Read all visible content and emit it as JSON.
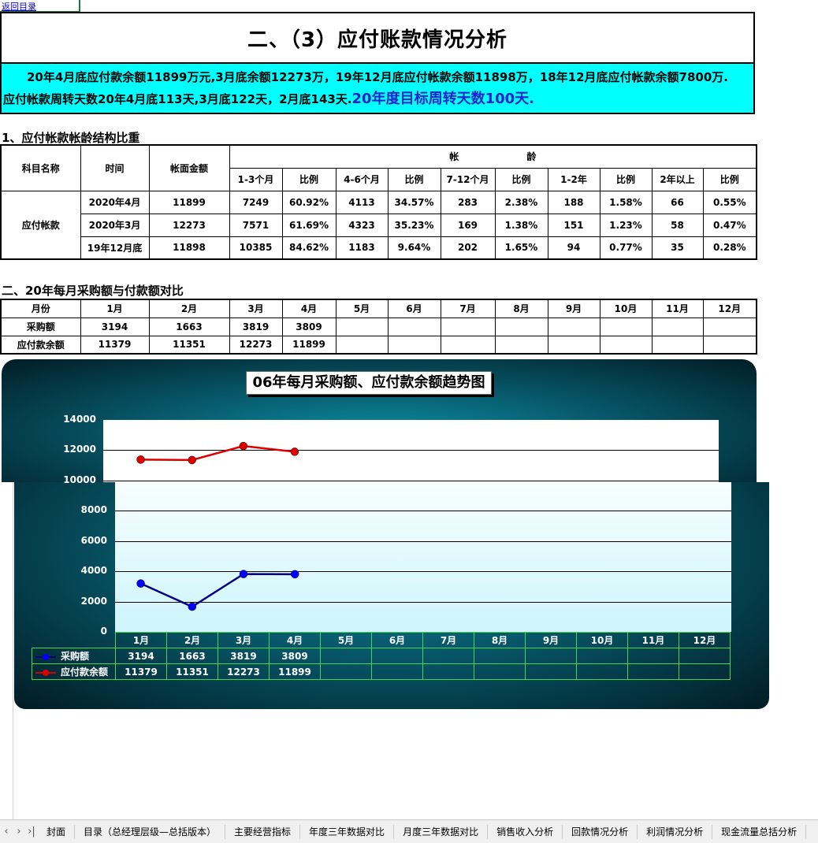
{
  "back_link": "返回目录",
  "title": "二、（3）应付账款情况分析",
  "summary": {
    "line1": "20年4月底应付款余额11899万元,3月底余额12273万，19年12月底应付帐款余额11898万，18年12月底应付帐款余额7800万.",
    "line2": "应付帐款周转天数20年4月底113天,3月底122天，2月底143天.",
    "target": "20年度目标周转天数100天."
  },
  "section1": "1、应付帐款帐龄结构比重",
  "aging": {
    "h_subject": "科目名称",
    "h_time": "时间",
    "h_amount": "帐面金额",
    "h_age1": "帐",
    "h_age2": "龄",
    "buckets": [
      "1-3个月",
      "比例",
      "4-6个月",
      "比例",
      "7-12个月",
      "比例",
      "1-2年",
      "比例",
      "2年以上",
      "比例"
    ],
    "subject": "应付帐款",
    "rows": [
      {
        "time": "2020年4月",
        "amount": "11899",
        "cells": [
          "7249",
          "60.92%",
          "4113",
          "34.57%",
          "283",
          "2.38%",
          "188",
          "1.58%",
          "66",
          "0.55%"
        ]
      },
      {
        "time": "2020年3月",
        "amount": "12273",
        "cells": [
          "7571",
          "61.69%",
          "4323",
          "35.23%",
          "169",
          "1.38%",
          "151",
          "1.23%",
          "58",
          "0.47%"
        ]
      },
      {
        "time": "19年12月底",
        "amount": "11898",
        "cells": [
          "10385",
          "84.62%",
          "1183",
          "9.64%",
          "202",
          "1.65%",
          "94",
          "0.77%",
          "35",
          "0.28%"
        ]
      }
    ]
  },
  "section2": "二、20年每月采购额与付款额对比",
  "monthly": {
    "h_month": "月份",
    "months": [
      "1月",
      "2月",
      "3月",
      "4月",
      "5月",
      "6月",
      "7月",
      "8月",
      "9月",
      "10月",
      "11月",
      "12月"
    ],
    "r1_label": "采购额",
    "r1": [
      "3194",
      "1663",
      "3819",
      "3809",
      "",
      "",
      "",
      "",
      "",
      "",
      "",
      ""
    ],
    "r2_label": "应付款余额",
    "r2": [
      "11379",
      "11351",
      "12273",
      "11899",
      "",
      "",
      "",
      "",
      "",
      "",
      "",
      ""
    ]
  },
  "chart_data": {
    "type": "line",
    "title": "06年每月采购额、应付款余额趋势图",
    "categories": [
      "1月",
      "2月",
      "3月",
      "4月",
      "5月",
      "6月",
      "7月",
      "8月",
      "9月",
      "10月",
      "11月",
      "12月"
    ],
    "series": [
      {
        "name": "采购额",
        "values": [
          3194,
          1663,
          3819,
          3809,
          null,
          null,
          null,
          null,
          null,
          null,
          null,
          null
        ],
        "color": "#000080",
        "marker": "#0000ff"
      },
      {
        "name": "应付款余额",
        "values": [
          11379,
          11351,
          12273,
          11899,
          null,
          null,
          null,
          null,
          null,
          null,
          null,
          null
        ],
        "color": "#dd0000",
        "marker": "#dd0000"
      }
    ],
    "ylim": [
      0,
      14000
    ],
    "yticks": [
      0,
      2000,
      4000,
      6000,
      8000,
      10000,
      12000,
      14000
    ],
    "grid": true,
    "legend": "data-table"
  },
  "tabs": [
    "封面",
    "目录（总经理层级—总括版本）",
    "主要经营指标",
    "年度三年数据对比",
    "月度三年数据对比",
    "销售收入分析",
    "回款情况分析",
    "利润情况分析",
    "现金流量总括分析"
  ]
}
